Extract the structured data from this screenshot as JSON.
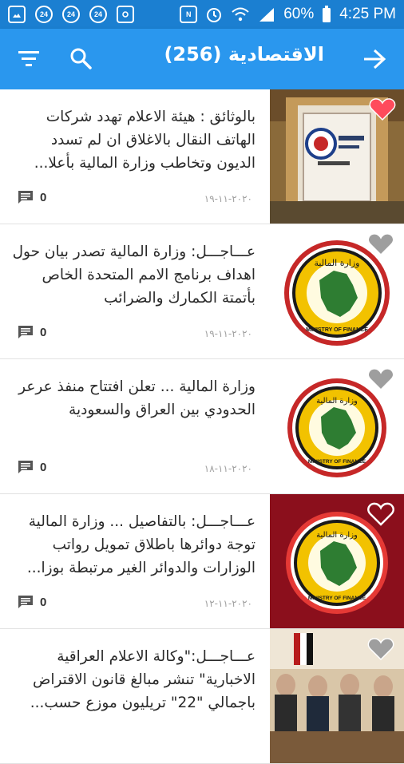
{
  "status_bar": {
    "battery": "60%",
    "time": "4:25 PM",
    "icons": [
      "image-icon",
      "notification-24-icon",
      "notification-24-icon",
      "notification-24-icon",
      "instagram-icon",
      "nfc-icon",
      "alarm-icon",
      "wifi-icon",
      "signal-icon",
      "battery-icon"
    ]
  },
  "app_bar": {
    "title": "الاقتصادية (256)",
    "icons": [
      "back-arrow-icon",
      "search-icon",
      "filter-icon"
    ],
    "accent": "#2a97ee",
    "status_color": "#1b7fd1"
  },
  "articles": [
    {
      "headline": "بالوثائق : هيئة الاعلام تهدد شركات الهاتف النقال بالاغلاق ان لم تسدد الديون وتخاطب وزارة المالية بأعلا...",
      "date": "٢٠٢٠-١١-١٩",
      "comments": "0",
      "favorite": true,
      "thumb": "building"
    },
    {
      "headline": "عـــاجـــل: وزارة المالية تصدر بيان حول اهداف برنامج الامم المتحدة الخاص بأتمتة الكمارك والضرائب",
      "date": "٢٠٢٠-١١-١٩",
      "comments": "0",
      "favorite": false,
      "thumb": "logo"
    },
    {
      "headline": "وزارة المالية ... تعلن افتتاح منفذ عرعر الحدودي بين العراق والسعودية",
      "date": "٢٠٢٠-١١-١٨",
      "comments": "0",
      "favorite": false,
      "thumb": "logo"
    },
    {
      "headline": "عـــاجـــل: بالتفاصيل ... وزارة المالية توجة دوائرها باطلاق تمويل رواتب الوزارات والدوائر الغير مرتبطة بوزا...",
      "date": "٢٠٢٠-١١-١٢",
      "comments": "0",
      "favorite": false,
      "thumb": "logo-red"
    },
    {
      "headline": "عـــاجـــل:\"وكالة الاعلام العراقية الاخبارية\" تنشر مبالغ قانون الاقتراض باجمالي \"22\" تريليون موزع حسب...",
      "date": "",
      "comments": "",
      "favorite": false,
      "thumb": "meeting"
    }
  ],
  "logo_text": {
    "arabic": "وزارة المالية",
    "english": "MINISTRY OF FINANCE"
  },
  "colors": {
    "heart_active": "#ff4b5c",
    "heart_inactive": "#9e9e9e"
  }
}
